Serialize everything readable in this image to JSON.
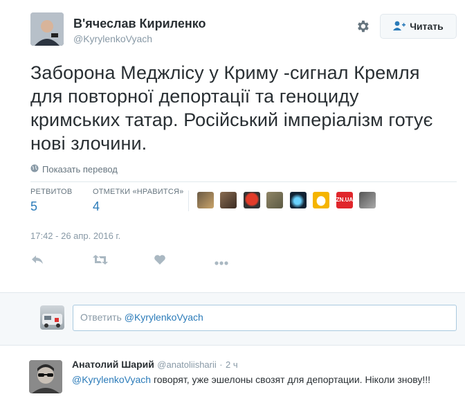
{
  "tweet": {
    "author_name": "В'ячеслав Кириленко",
    "author_handle": "@KyrylenkoVyach",
    "follow_label": "Читать",
    "text": "Заборона Меджлісу у Криму -сигнал Кремля для повторної депортації та геноциду кримських татар. Російський імперіалізм готує нові злочини.",
    "translate_label": "Показать перевод",
    "stats": {
      "retweets_label": "РЕТВИТОВ",
      "retweets_value": "5",
      "likes_label": "ОТМЕТКИ «НРАВИТСЯ»",
      "likes_value": "4"
    },
    "likers_badge_text": "ZN.UA",
    "timestamp": "17:42 - 26 апр. 2016 г."
  },
  "reply_box": {
    "prefix": "Ответить ",
    "mention": "@KyrylenkoVyach"
  },
  "comment": {
    "author_name": "Анатолий Шарий",
    "author_handle": "@anatoliishariі",
    "separator": "·",
    "time": "2 ч",
    "mention": "@KyrylenkoVyach",
    "text": " говорят, уже эшелоны свозят для депортации. Ніколи знову!!!"
  },
  "colors": {
    "link": "#2b7bb9",
    "muted": "#8899a6",
    "text": "#292f33"
  },
  "icons": [
    "gear-icon",
    "follow-user-icon",
    "globe-icon",
    "reply-icon",
    "retweet-icon",
    "like-icon",
    "more-icon"
  ]
}
